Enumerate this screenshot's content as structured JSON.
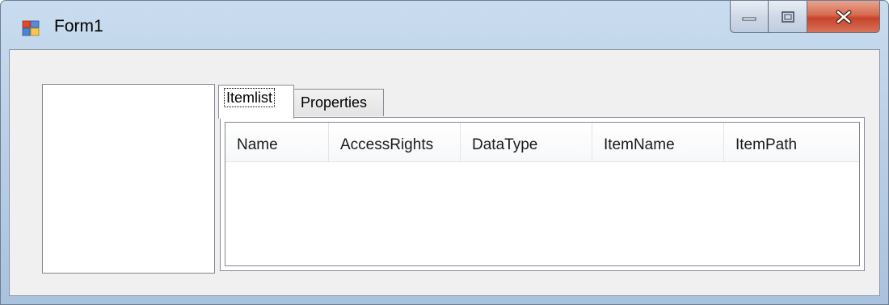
{
  "window": {
    "title": "Form1",
    "caption_buttons": [
      "minimize",
      "maximize",
      "close"
    ]
  },
  "tabs": [
    {
      "label": "Itemlist",
      "active": true
    },
    {
      "label": "Properties",
      "active": false
    }
  ],
  "listview": {
    "columns": [
      "Name",
      "AccessRights",
      "DataType",
      "ItemName",
      "ItemPath"
    ],
    "rows": []
  },
  "colors": {
    "title_gradient_top": "#c9dcef",
    "client_background": "#f0f0f0",
    "close_button": "#c7432a"
  },
  "icons": {
    "app": "form-app-icon",
    "minimize": "minimize-icon",
    "maximize": "maximize-icon",
    "close": "close-icon"
  }
}
